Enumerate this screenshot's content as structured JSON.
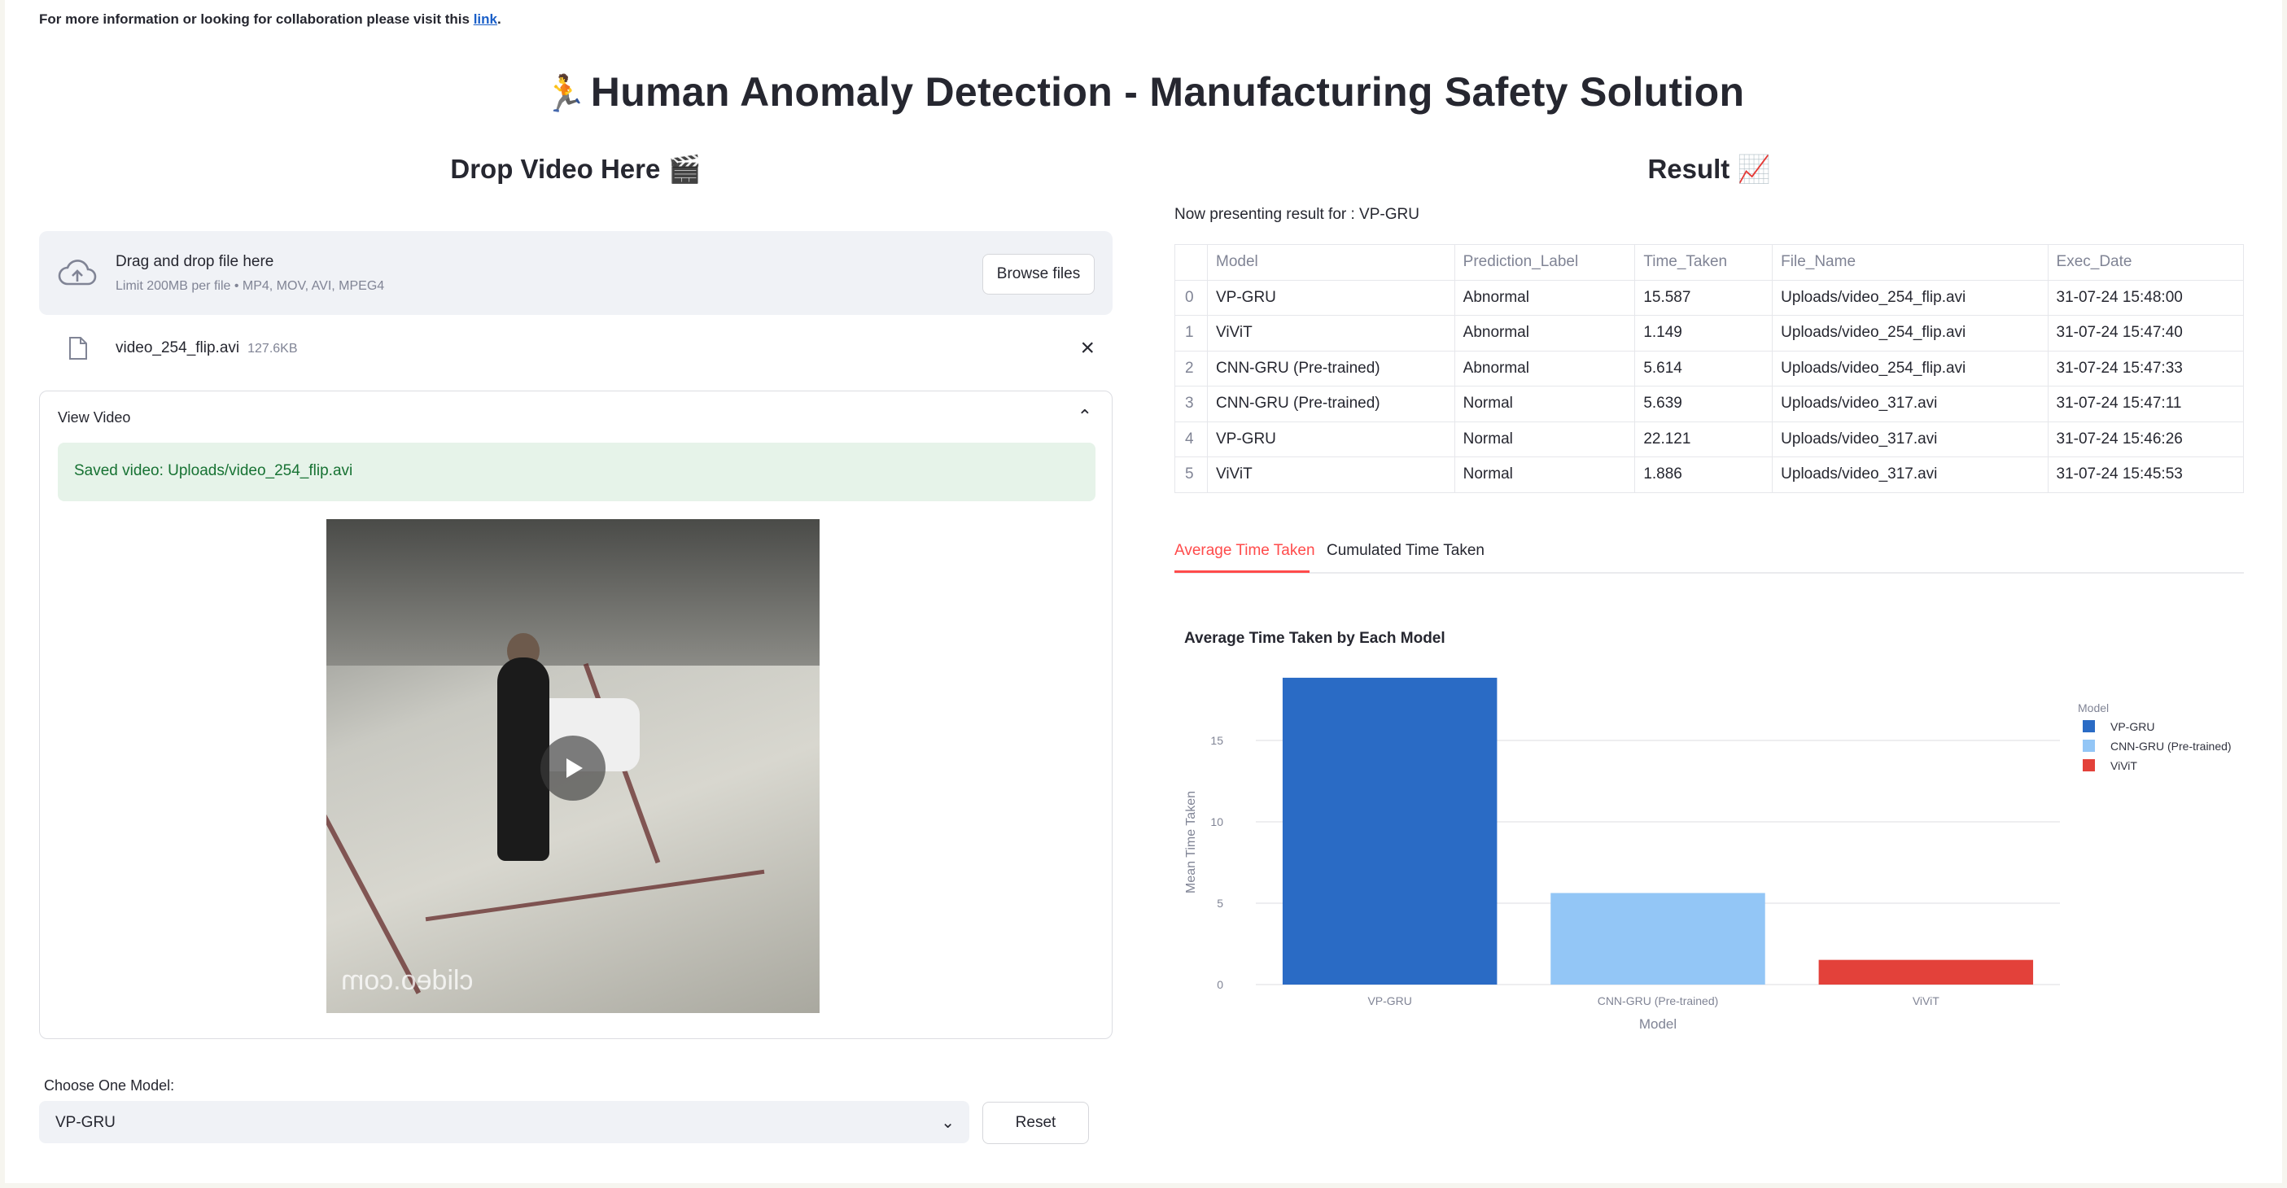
{
  "header": {
    "note_prefix": "For more information or looking for collaboration please visit this ",
    "note_link": "link",
    "note_suffix": ".",
    "title_emoji": "🏃",
    "title": "Human Anomaly Detection - Manufacturing Safety Solution"
  },
  "left": {
    "heading": "Drop Video Here",
    "heading_emoji": "🎬",
    "uploader": {
      "title": "Drag and drop file here",
      "subtitle": "Limit 200MB per file • MP4, MOV, AVI, MPEG4",
      "browse_label": "Browse files"
    },
    "file": {
      "name": "video_254_flip.avi",
      "size": "127.6KB"
    },
    "expander": {
      "label": "View Video",
      "success": "Saved video: Uploads/video_254_flip.avi",
      "watermark": "clideo.com"
    },
    "model_select": {
      "label": "Choose One Model:",
      "value": "VP-GRU"
    },
    "reset_label": "Reset"
  },
  "right": {
    "heading": "Result",
    "heading_emoji": "📈",
    "presenting": "Now presenting result for : VP-GRU",
    "table": {
      "columns": [
        "Model",
        "Prediction_Label",
        "Time_Taken",
        "File_Name",
        "Exec_Date"
      ],
      "rows": [
        {
          "idx": "0",
          "cells": [
            "VP-GRU",
            "Abnormal",
            "15.587",
            "Uploads/video_254_flip.avi",
            "31-07-24 15:48:00"
          ]
        },
        {
          "idx": "1",
          "cells": [
            "ViViT",
            "Abnormal",
            "1.149",
            "Uploads/video_254_flip.avi",
            "31-07-24 15:47:40"
          ]
        },
        {
          "idx": "2",
          "cells": [
            "CNN-GRU (Pre-trained)",
            "Abnormal",
            "5.614",
            "Uploads/video_254_flip.avi",
            "31-07-24 15:47:33"
          ]
        },
        {
          "idx": "3",
          "cells": [
            "CNN-GRU (Pre-trained)",
            "Normal",
            "5.639",
            "Uploads/video_317.avi",
            "31-07-24 15:47:11"
          ]
        },
        {
          "idx": "4",
          "cells": [
            "VP-GRU",
            "Normal",
            "22.121",
            "Uploads/video_317.avi",
            "31-07-24 15:46:26"
          ]
        },
        {
          "idx": "5",
          "cells": [
            "ViViT",
            "Normal",
            "1.886",
            "Uploads/video_317.avi",
            "31-07-24 15:45:53"
          ]
        }
      ]
    },
    "tabs": [
      {
        "label": "Average Time Taken",
        "active": true
      },
      {
        "label": "Cumulated Time Taken",
        "active": false
      }
    ]
  },
  "chart_data": {
    "type": "bar",
    "title": "Average Time Taken by Each Model",
    "xlabel": "Model",
    "ylabel": "Mean Time Taken",
    "categories": [
      "VP-GRU",
      "CNN-GRU (Pre-trained)",
      "ViViT"
    ],
    "values": [
      18.854,
      5.6265,
      1.5175
    ],
    "colors": [
      "#2a6bc5",
      "#93c6f6",
      "#e3413a"
    ],
    "ylim": [
      0,
      19.5
    ],
    "yticks": [
      0,
      5,
      10,
      15
    ],
    "grid": true,
    "legend": {
      "title": "Model",
      "placement": "top-right",
      "entries": [
        "VP-GRU",
        "CNN-GRU (Pre-trained)",
        "ViViT"
      ]
    }
  }
}
